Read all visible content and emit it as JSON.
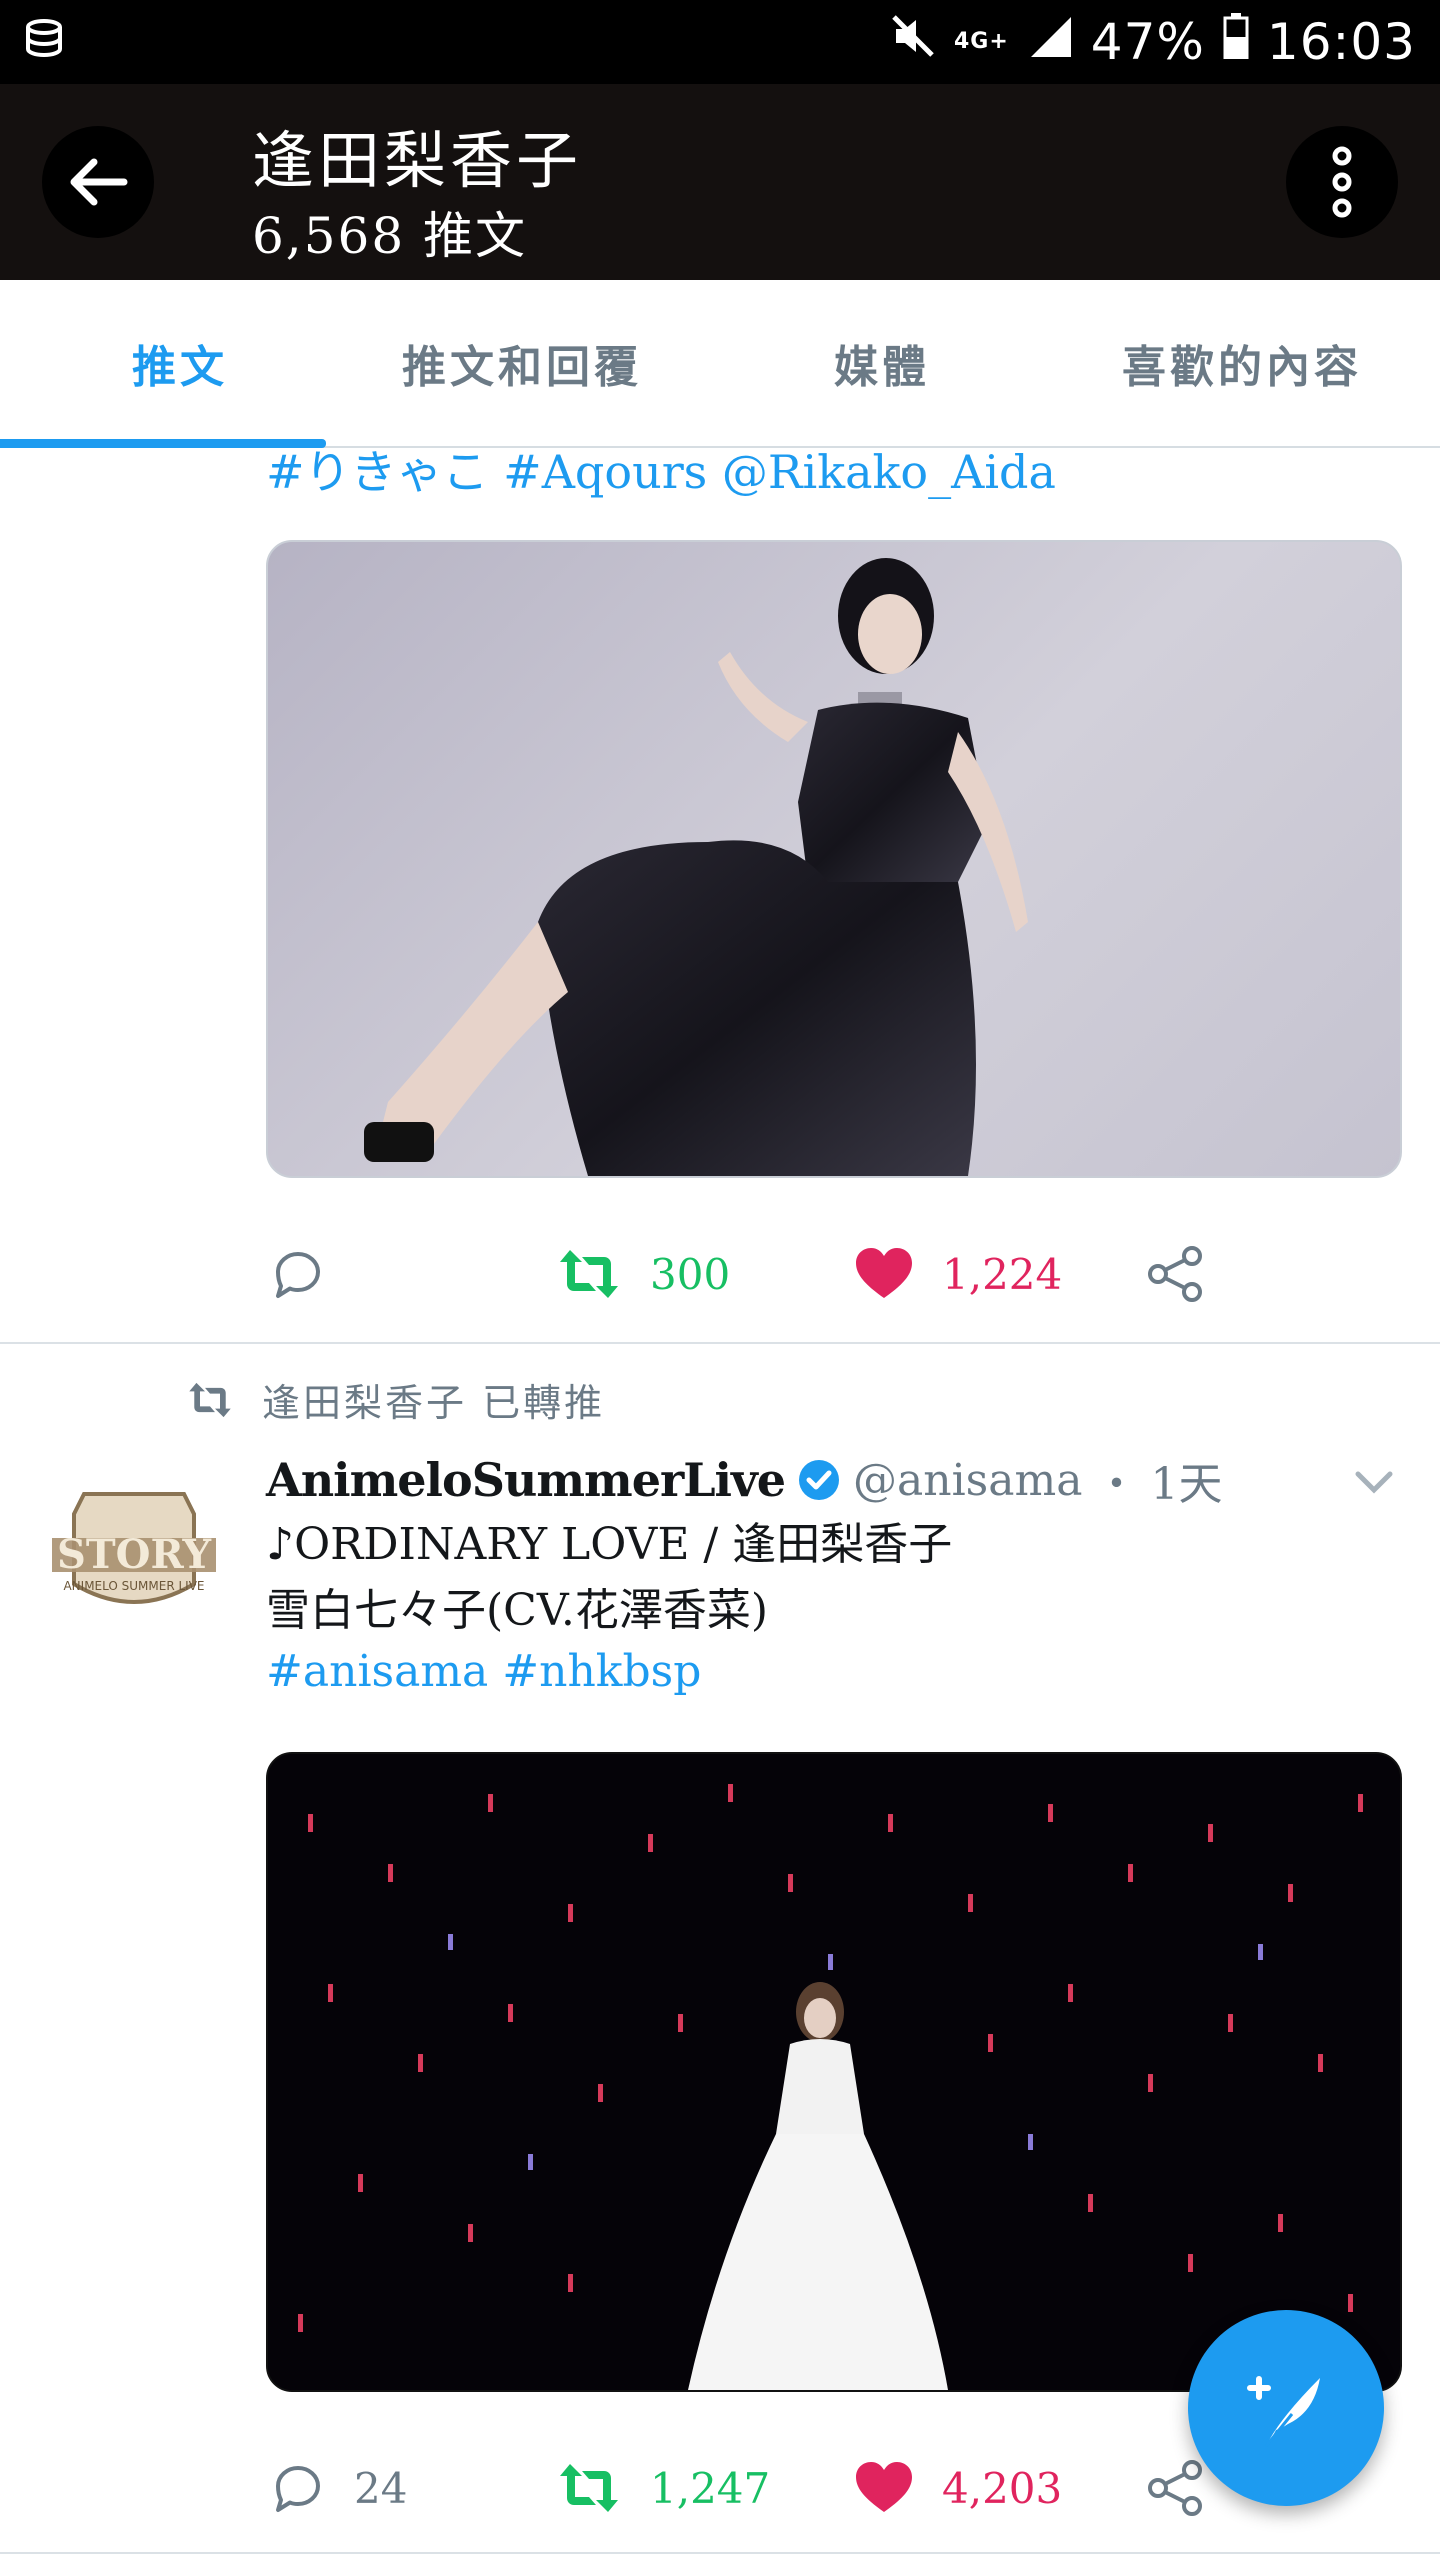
{
  "status_bar": {
    "network": "4G+",
    "battery": "47%",
    "time": "16:03",
    "icons": [
      "sim-icon",
      "mute-icon",
      "signal-icon",
      "battery-icon"
    ]
  },
  "app_bar": {
    "title": "逢田梨香子",
    "subtitle": "6,568 推文"
  },
  "tabs": [
    {
      "label": "推文",
      "active": true
    },
    {
      "label": "推文和回覆",
      "active": false
    },
    {
      "label": "媒體",
      "active": false
    },
    {
      "label": "喜歡的內容",
      "active": false
    }
  ],
  "tweet1": {
    "hashtags": "#りきゃこ #Aqours @Rikako_Aida",
    "replies": "",
    "retweets": "300",
    "likes": "1,224"
  },
  "tweet2": {
    "retweeted_by": "逢田梨香子 已轉推",
    "author_name": "AnimeloSummerLive",
    "handle": "@anisama",
    "separator": "・",
    "time": "1天",
    "text_line1": "♪ORDINARY LOVE / 逢田梨香子",
    "text_line2": "雪白七々子(CV.花澤香菜)",
    "hashtags": "#anisama #nhkbsp",
    "replies": "24",
    "retweets": "1,247",
    "likes": "4,203",
    "avatar_text": "STORY",
    "avatar_subtext": "ANIMELO SUMMER LIVE"
  },
  "colors": {
    "accent": "#1d9bf0",
    "retweet": "#17bf63",
    "like": "#e0245e",
    "muted": "#6b7a86"
  }
}
